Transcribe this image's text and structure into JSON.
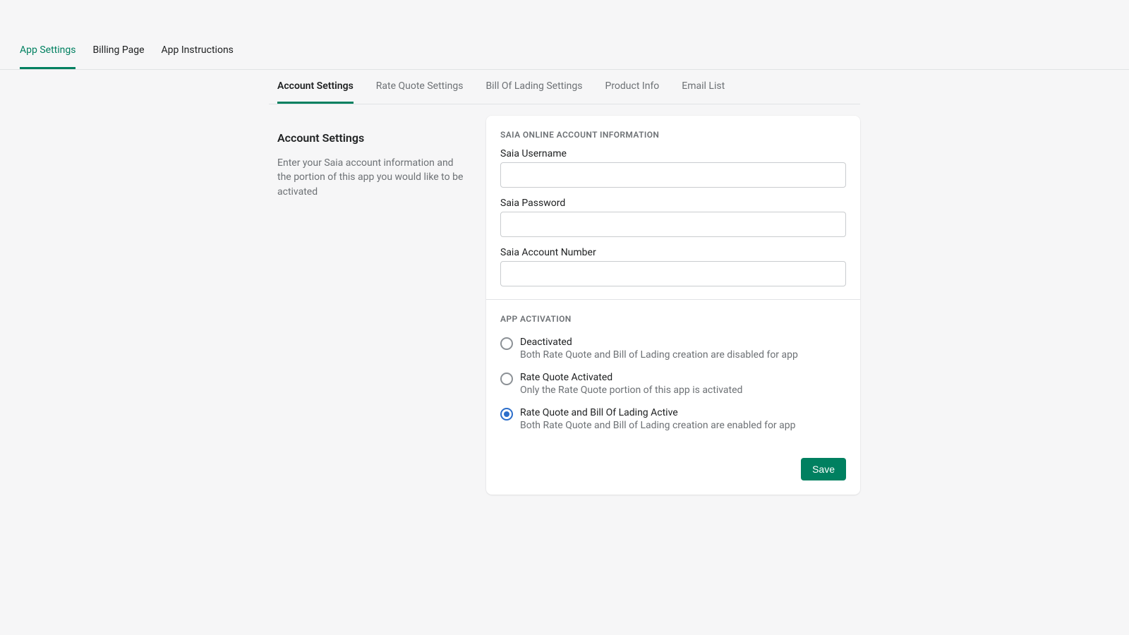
{
  "topTabs": {
    "appSettings": "App Settings",
    "billingPage": "Billing Page",
    "appInstructions": "App Instructions"
  },
  "subTabs": {
    "accountSettings": "Account Settings",
    "rateQuoteSettings": "Rate Quote Settings",
    "billOfLadingSettings": "Bill Of Lading Settings",
    "productInfo": "Product Info",
    "emailList": "Email List"
  },
  "side": {
    "title": "Account Settings",
    "description": "Enter your Saia account information and the portion of this app you would like to be activated"
  },
  "section1": {
    "heading": "SAIA ONLINE ACCOUNT INFORMATION",
    "usernameLabel": "Saia Username",
    "usernameValue": "",
    "passwordLabel": "Saia Password",
    "passwordValue": "",
    "accountNumberLabel": "Saia Account Number",
    "accountNumberValue": ""
  },
  "section2": {
    "heading": "APP ACTIVATION",
    "options": [
      {
        "label": "Deactivated",
        "help": "Both Rate Quote and Bill of Lading creation are disabled for app",
        "selected": false
      },
      {
        "label": "Rate Quote Activated",
        "help": "Only the Rate Quote portion of this app is activated",
        "selected": false
      },
      {
        "label": "Rate Quote and Bill Of Lading Active",
        "help": "Both Rate Quote and Bill of Lading creation are enabled for app",
        "selected": true
      }
    ]
  },
  "buttons": {
    "save": "Save"
  }
}
